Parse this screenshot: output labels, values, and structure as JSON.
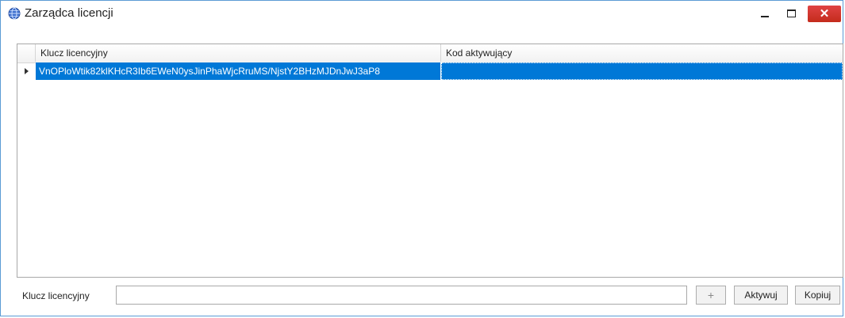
{
  "window": {
    "title": "Zarządca licencji",
    "icon": "globe-icon",
    "controls": {
      "minimize": "minimize-icon",
      "maximize": "maximize-icon",
      "close_symbol": "✕"
    }
  },
  "grid": {
    "columns": [
      "Klucz licencyjny",
      "Kod aktywujący"
    ],
    "rows": [
      {
        "license_key": "VnOPloWtik82klKHcR3Ib6EWeN0ysJinPhaWjcRruMS/NjstY2BHzMJDnJwJ3aP8",
        "activation_code": ""
      }
    ],
    "selection_color": "#0078d7"
  },
  "footer": {
    "label": "Klucz licencyjny",
    "input_value": "",
    "add_label": "+",
    "activate_label": "Aktywuj",
    "copy_label": "Kopiuj"
  }
}
